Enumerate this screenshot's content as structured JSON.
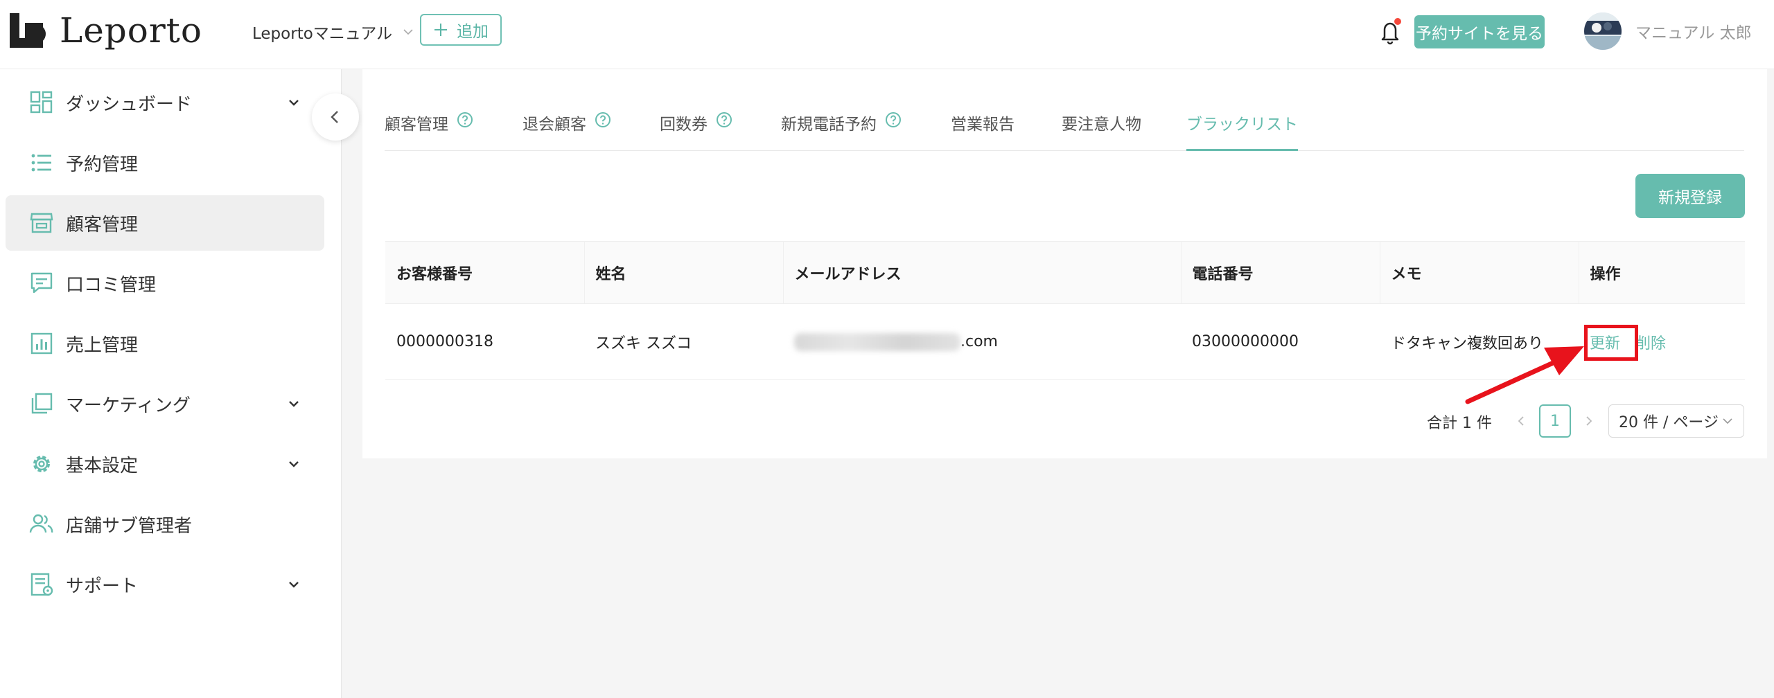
{
  "header": {
    "logo_text": "Leporto",
    "workspace": "Leportoマニュアル",
    "add_label": "追加",
    "site_button": "予約サイトを見る",
    "username": "マニュアル 太郎",
    "icons": [
      "bell-icon",
      "plus-icon",
      "chevron-down-icon"
    ]
  },
  "sidebar": {
    "items": [
      {
        "label": "ダッシュボード",
        "icon": "dashboard-icon",
        "has_chevron": true
      },
      {
        "label": "予約管理",
        "icon": "list-icon",
        "has_chevron": false
      },
      {
        "label": "顧客管理",
        "icon": "store-icon",
        "has_chevron": false,
        "active": true
      },
      {
        "label": "口コミ管理",
        "icon": "comment-icon",
        "has_chevron": false
      },
      {
        "label": "売上管理",
        "icon": "chart-icon",
        "has_chevron": false
      },
      {
        "label": "マーケティング",
        "icon": "layers-icon",
        "has_chevron": true
      },
      {
        "label": "基本設定",
        "icon": "gear-icon",
        "has_chevron": true
      },
      {
        "label": "店舗サブ管理者",
        "icon": "users-icon",
        "has_chevron": false
      },
      {
        "label": "サポート",
        "icon": "support-icon",
        "has_chevron": true
      }
    ]
  },
  "tabs": [
    {
      "label": "顧客管理",
      "help": true
    },
    {
      "label": "退会顧客",
      "help": true
    },
    {
      "label": "回数券",
      "help": true
    },
    {
      "label": "新規電話予約",
      "help": true
    },
    {
      "label": "営業報告",
      "help": false
    },
    {
      "label": "要注意人物",
      "help": false
    },
    {
      "label": "ブラックリスト",
      "help": false,
      "active": true
    }
  ],
  "new_button": "新規登録",
  "table": {
    "headers": [
      "お客様番号",
      "姓名",
      "メールアドレス",
      "電話番号",
      "メモ",
      "操作"
    ],
    "rows": [
      {
        "customer_no": "0000000318",
        "name": "スズキ スズコ",
        "email_suffix": ".com",
        "phone": "03000000000",
        "memo": "ドタキャン複数回あり",
        "action_update": "更新",
        "action_delete": "削除"
      }
    ]
  },
  "pagination": {
    "total": "合計 1 件",
    "current_page": "1",
    "page_size": "20 件 / ページ"
  },
  "colors": {
    "accent": "#66bcae",
    "annotation": "#e8131c"
  }
}
